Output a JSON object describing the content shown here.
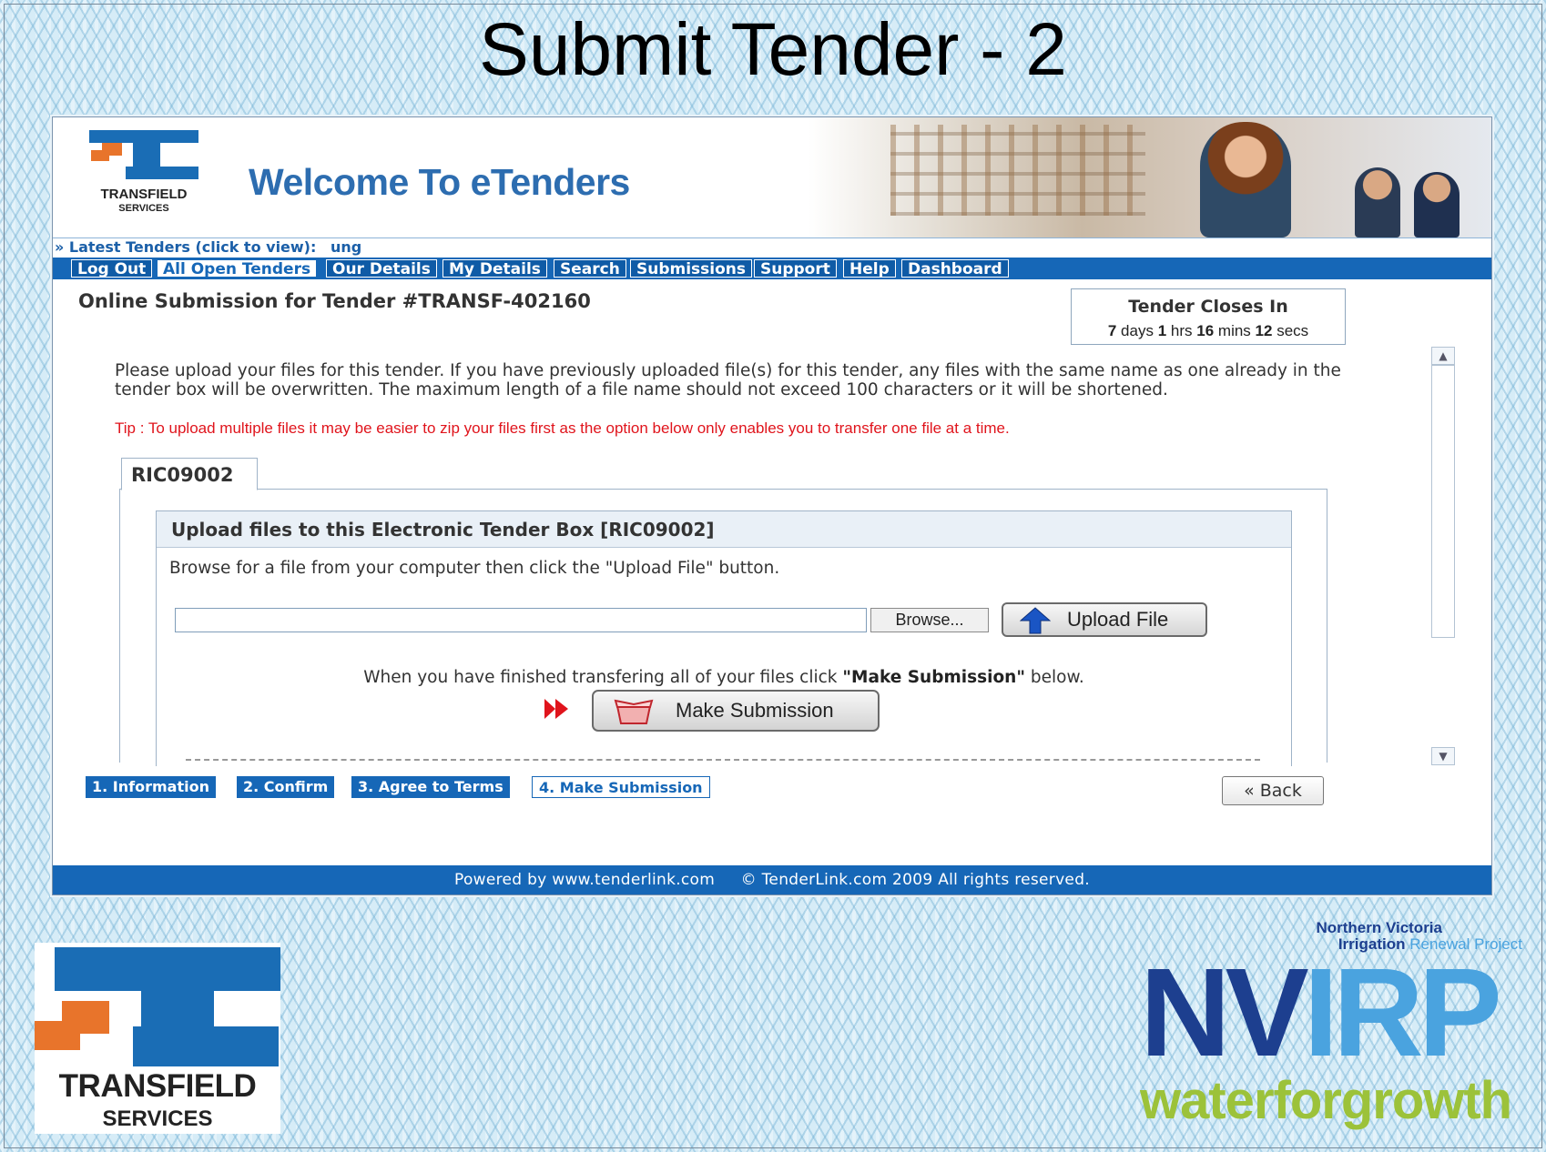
{
  "slide": {
    "title": "Submit Tender - 2"
  },
  "banner": {
    "logo_line1": "TRANSFIELD",
    "logo_line2": "SERVICES",
    "welcome": "Welcome To eTenders"
  },
  "latest": {
    "label": "» Latest Tenders (click to view):",
    "ticker": "ung"
  },
  "nav": {
    "items": [
      {
        "label": "Log Out"
      },
      {
        "label": "All Open Tenders",
        "active": true
      },
      {
        "label": "Our Details"
      },
      {
        "label": "My Details"
      },
      {
        "label": "Search"
      },
      {
        "label": "Submissions"
      },
      {
        "label": "Support"
      },
      {
        "label": "Help"
      },
      {
        "label": "Dashboard"
      }
    ]
  },
  "page": {
    "title": "Online Submission for Tender #TRANSF-402160"
  },
  "closes": {
    "heading": "Tender Closes In",
    "days": "7",
    "days_unit": "days",
    "hrs": "1",
    "hrs_unit": "hrs",
    "mins": "16",
    "mins_unit": "mins",
    "secs": "12",
    "secs_unit": "secs"
  },
  "intro": {
    "text": "Please upload your files for this tender. If you have previously uploaded file(s) for this tender, any files with the same name as one already in the tender box will be overwritten. The maximum length of a file name should not exceed 100 characters or it will be shortened.",
    "tip": "Tip : To upload multiple files it may be easier to zip your files first as the option below only enables you to transfer one file at a time."
  },
  "tab": {
    "label": "RIC09002"
  },
  "upload": {
    "heading": "Upload files to this Electronic Tender Box [RIC09002]",
    "browse_text": "Browse for a file from your computer then click the \"Upload File\" button.",
    "file_value": "",
    "browse_label": "Browse...",
    "upload_label": "Upload File",
    "finished_before": "When you have finished transfering all of your files click ",
    "finished_bold": "\"Make Submission\"",
    "finished_after": " below.",
    "submit_label": "Make Submission"
  },
  "steps": [
    {
      "label": "1. Information"
    },
    {
      "label": "2. Confirm"
    },
    {
      "label": "3. Agree to Terms"
    },
    {
      "label": "4. Make Submission",
      "current": true
    }
  ],
  "back_label": "« Back",
  "footer": {
    "text": "Powered by www.tenderlink.com     © TenderLink.com 2009 All rights reserved."
  },
  "logos": {
    "transfield_line1": "TRANSFIELD",
    "transfield_line2": "SERVICES",
    "nvirp_sub1": "Northern Victoria",
    "nvirp_sub2_dark": "Irrigation",
    "nvirp_sub2_light": " Renewal Project",
    "nvirp_nv": "NV",
    "nvirp_rp": "IRP",
    "nvirp_tag": "waterforgrowth"
  },
  "colors": {
    "nav_blue": "#1667b7",
    "tip_red": "#e0141c",
    "transfield_orange": "#e8742b",
    "nvirp_navy": "#1d3f8f",
    "nvirp_lightblue": "#4aa3df",
    "nvirp_green": "#9cc23a"
  },
  "icons": [
    "upload-arrow-icon",
    "double-arrow-icon",
    "tender-box-icon",
    "scroll-up-icon",
    "scroll-down-icon"
  ]
}
